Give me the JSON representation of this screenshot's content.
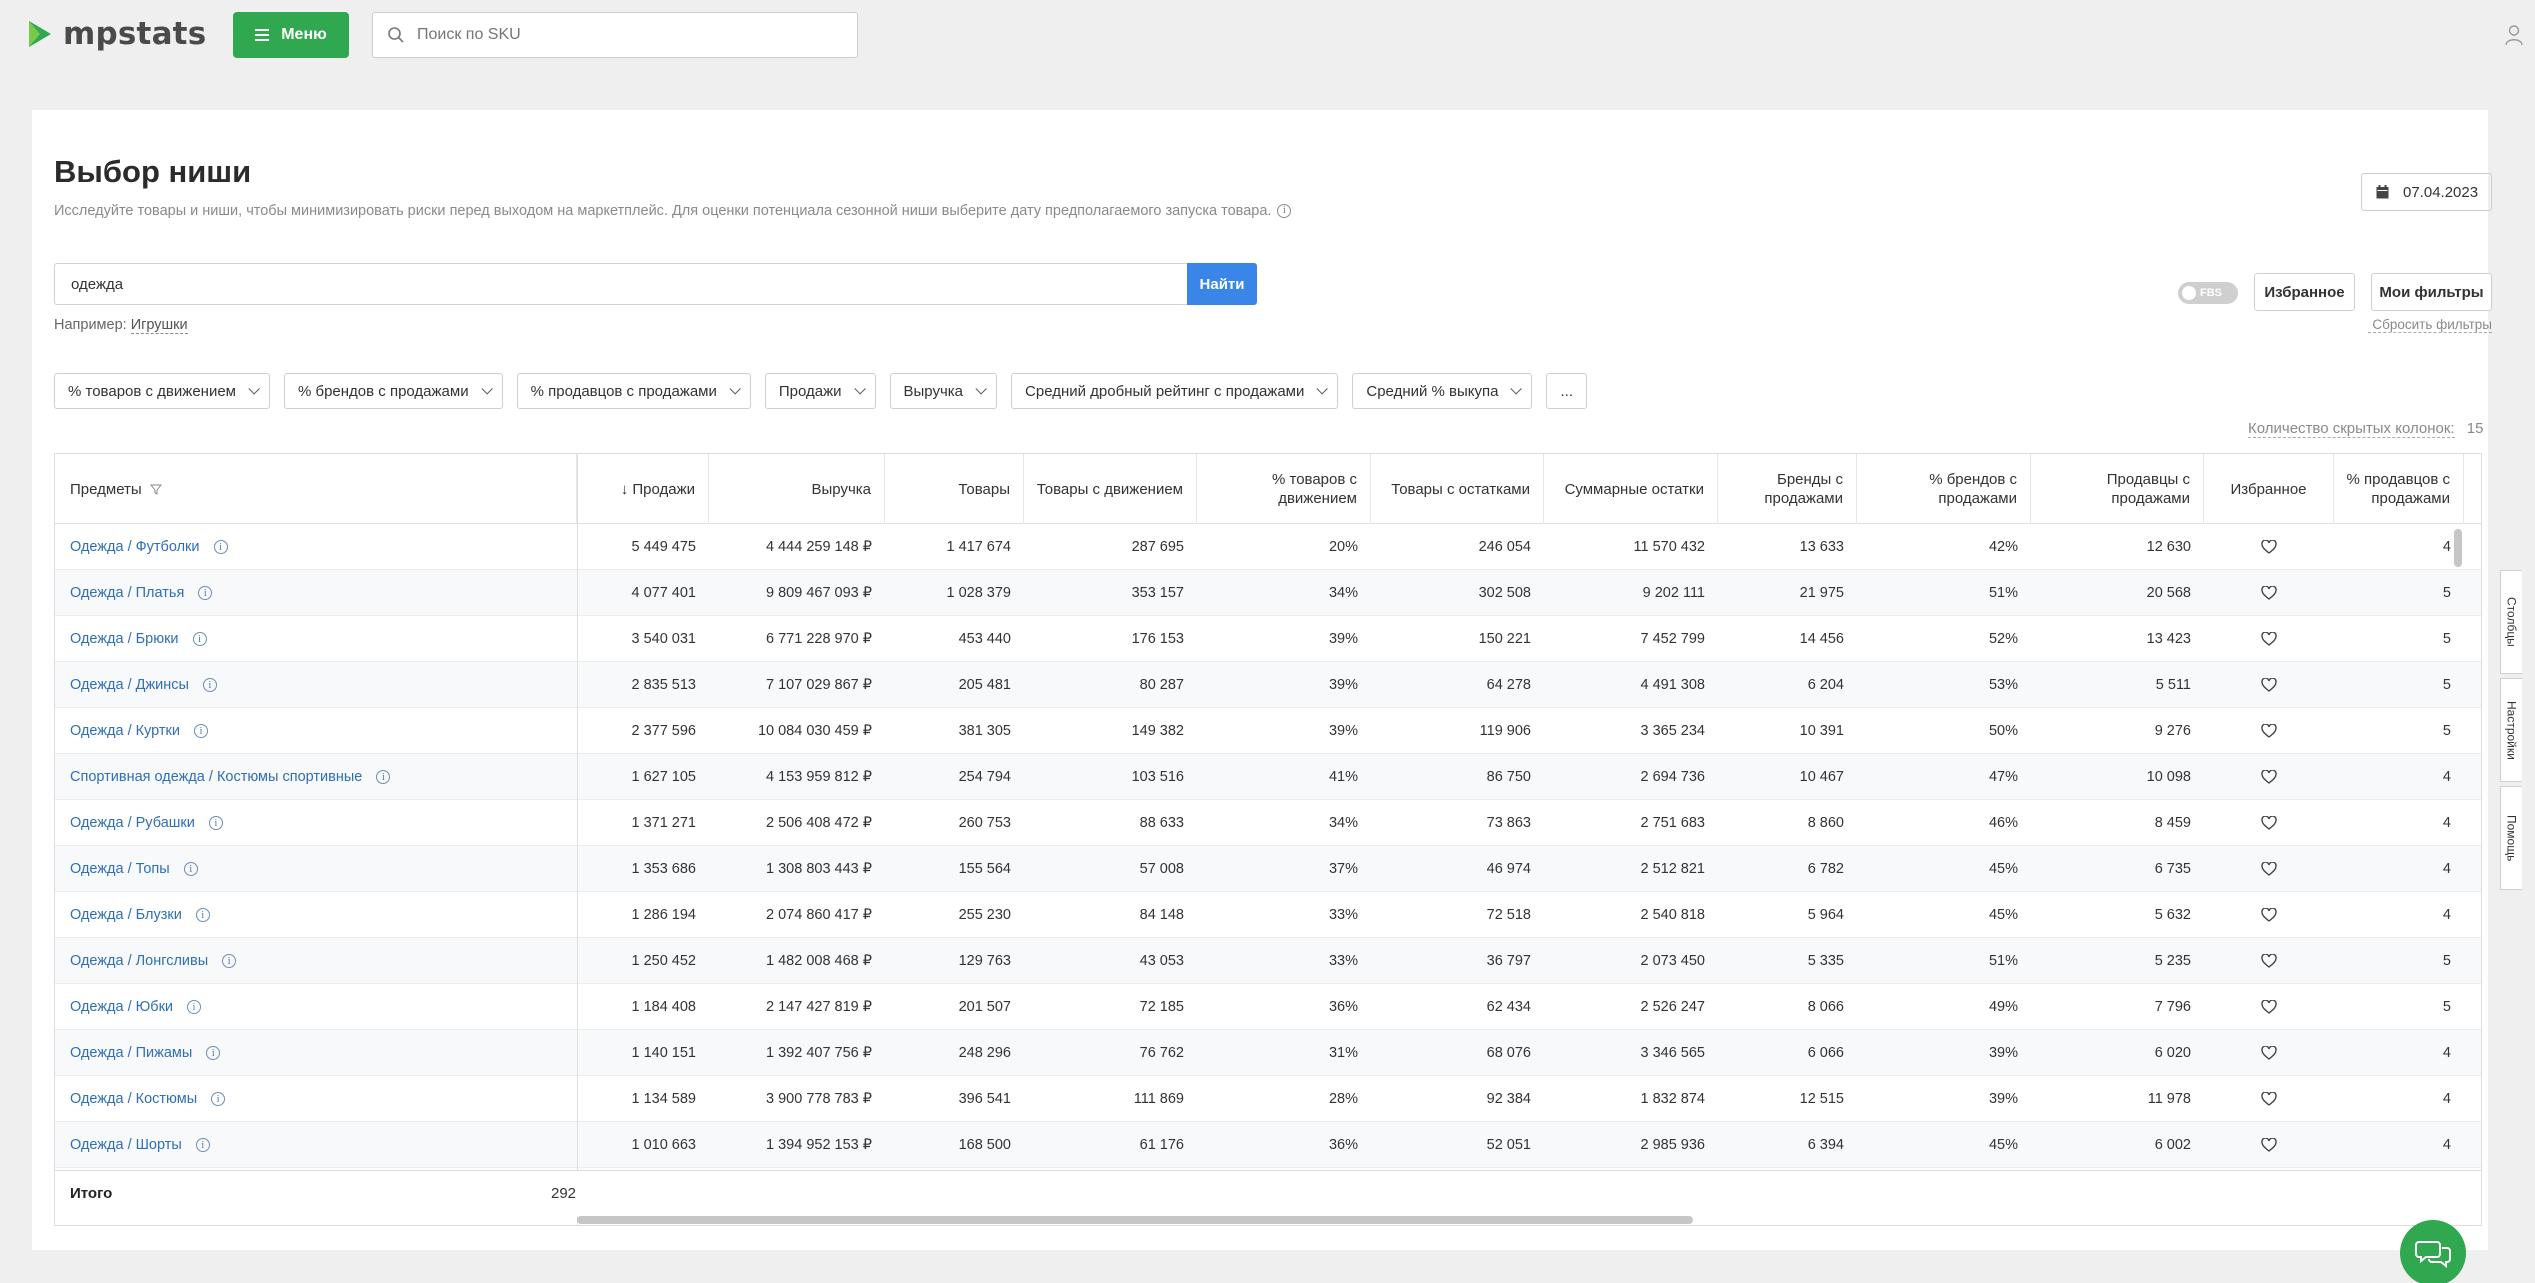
{
  "brand": {
    "name": "mpstats",
    "color": "#2fa84f"
  },
  "topbar": {
    "menu_label": "Меню",
    "sku_placeholder": "Поиск по SKU"
  },
  "page": {
    "title": "Выбор ниши",
    "description": "Исследуйте товары и ниши, чтобы минимизировать риски перед выходом на маркетплейс. Для оценки потенциала сезонной ниши выберите дату предполагаемого запуска товара.",
    "date": "07.04.2023",
    "search_value": "одежда",
    "find_label": "Найти",
    "example_label": "Например:",
    "example_link": "Игрушки",
    "fbs_label": "FBS",
    "favorites_label": "Избранное",
    "my_filters_label": "Мои фильтры",
    "reset_filters_label": "Сбросить фильтры",
    "hidden_columns_label": "Количество скрытых колонок:",
    "hidden_columns_count": "15"
  },
  "filter_chips": [
    "% товаров с движением",
    "% брендов с продажами",
    "% продавцов с продажами",
    "Продажи",
    "Выручка",
    "Средний дробный рейтинг с продажами",
    "Средний % выкупа",
    "..."
  ],
  "table": {
    "columns": [
      "Предметы",
      "↓ Продажи",
      "Выручка",
      "Товары",
      "Товары с движением",
      "% товаров с движением",
      "Товары с остатками",
      "Суммарные остатки",
      "Бренды с продажами",
      "% брендов с продажами",
      "Продавцы с продажами",
      "Избранное",
      "% продавцов с продажами"
    ],
    "rows": [
      [
        "Одежда / Футболки",
        "5 449 475",
        "4 444 259 148 ₽",
        "1 417 674",
        "287 695",
        "20%",
        "246 054",
        "11 570 432",
        "13 633",
        "42%",
        "12 630",
        "4"
      ],
      [
        "Одежда / Платья",
        "4 077 401",
        "9 809 467 093 ₽",
        "1 028 379",
        "353 157",
        "34%",
        "302 508",
        "9 202 111",
        "21 975",
        "51%",
        "20 568",
        "5"
      ],
      [
        "Одежда / Брюки",
        "3 540 031",
        "6 771 228 970 ₽",
        "453 440",
        "176 153",
        "39%",
        "150 221",
        "7 452 799",
        "14 456",
        "52%",
        "13 423",
        "5"
      ],
      [
        "Одежда / Джинсы",
        "2 835 513",
        "7 107 029 867 ₽",
        "205 481",
        "80 287",
        "39%",
        "64 278",
        "4 491 308",
        "6 204",
        "53%",
        "5 511",
        "5"
      ],
      [
        "Одежда / Куртки",
        "2 377 596",
        "10 084 030 459 ₽",
        "381 305",
        "149 382",
        "39%",
        "119 906",
        "3 365 234",
        "10 391",
        "50%",
        "9 276",
        "5"
      ],
      [
        "Спортивная одежда / Костюмы спортивные",
        "1 627 105",
        "4 153 959 812 ₽",
        "254 794",
        "103 516",
        "41%",
        "86 750",
        "2 694 736",
        "10 467",
        "47%",
        "10 098",
        "4"
      ],
      [
        "Одежда / Рубашки",
        "1 371 271",
        "2 506 408 472 ₽",
        "260 753",
        "88 633",
        "34%",
        "73 863",
        "2 751 683",
        "8 860",
        "46%",
        "8 459",
        "4"
      ],
      [
        "Одежда / Топы",
        "1 353 686",
        "1 308 803 443 ₽",
        "155 564",
        "57 008",
        "37%",
        "46 974",
        "2 512 821",
        "6 782",
        "45%",
        "6 735",
        "4"
      ],
      [
        "Одежда / Блузки",
        "1 286 194",
        "2 074 860 417 ₽",
        "255 230",
        "84 148",
        "33%",
        "72 518",
        "2 540 818",
        "5 964",
        "45%",
        "5 632",
        "4"
      ],
      [
        "Одежда / Лонгсливы",
        "1 250 452",
        "1 482 008 468 ₽",
        "129 763",
        "43 053",
        "33%",
        "36 797",
        "2 073 450",
        "5 335",
        "51%",
        "5 235",
        "5"
      ],
      [
        "Одежда / Юбки",
        "1 184 408",
        "2 147 427 819 ₽",
        "201 507",
        "72 185",
        "36%",
        "62 434",
        "2 526 247",
        "8 066",
        "49%",
        "7 796",
        "5"
      ],
      [
        "Одежда / Пижамы",
        "1 140 151",
        "1 392 407 756 ₽",
        "248 296",
        "76 762",
        "31%",
        "68 076",
        "3 346 565",
        "6 066",
        "39%",
        "6 020",
        "4"
      ],
      [
        "Одежда / Костюмы",
        "1 134 589",
        "3 900 778 783 ₽",
        "396 541",
        "111 869",
        "28%",
        "92 384",
        "1 832 874",
        "12 515",
        "39%",
        "11 978",
        "4"
      ],
      [
        "Одежда / Шорты",
        "1 010 663",
        "1 394 952 153 ₽",
        "168 500",
        "61 176",
        "36%",
        "52 051",
        "2 985 936",
        "6 394",
        "45%",
        "6 002",
        "4"
      ]
    ],
    "total_label": "Итого",
    "total_value": "292"
  },
  "side_tabs": [
    "Столбцы",
    "Настройки",
    "Помощь"
  ],
  "icons": {
    "search": "search-icon",
    "calendar": "calendar-icon",
    "heart": "heart-icon",
    "user": "user-icon",
    "chat": "chat-icon"
  }
}
